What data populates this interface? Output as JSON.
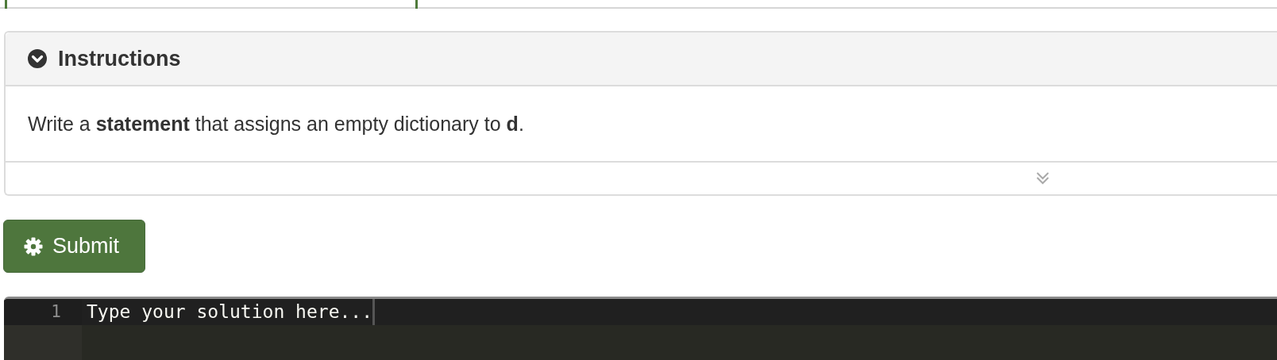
{
  "instructions_panel": {
    "title": "Instructions",
    "expanded": true,
    "text": "Write a **statement** that assigns an empty dictionary to **d**."
  },
  "submit_button": {
    "label": "Submit"
  },
  "code_editor": {
    "lines": [
      {
        "number": "1",
        "placeholder": "Type your solution here..."
      }
    ]
  }
}
